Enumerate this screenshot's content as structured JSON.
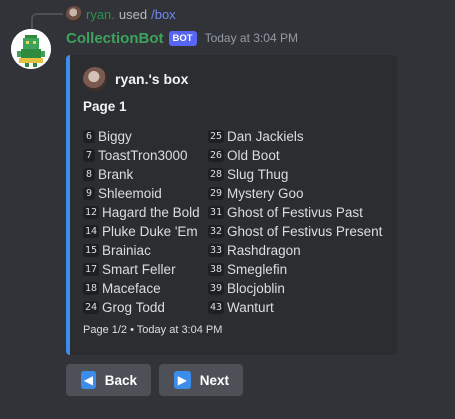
{
  "reply": {
    "user": "ryan.",
    "used": "used",
    "command": "/box"
  },
  "message": {
    "author": "CollectionBot",
    "tag": "BOT",
    "timestamp": "Today at 3:04 PM"
  },
  "embed": {
    "accent": "#3c8dea",
    "author": "ryan.'s box",
    "page_title": "Page 1",
    "left_items": [
      {
        "num": "6",
        "name": "Biggy"
      },
      {
        "num": "7",
        "name": "ToastTron3000"
      },
      {
        "num": "8",
        "name": "Brank"
      },
      {
        "num": "9",
        "name": "Shleemoid"
      },
      {
        "num": "12",
        "name": "Hagard the Bold"
      },
      {
        "num": "14",
        "name": "Pluke Duke 'Em"
      },
      {
        "num": "15",
        "name": "Brainiac"
      },
      {
        "num": "17",
        "name": "Smart Feller"
      },
      {
        "num": "18",
        "name": "Maceface"
      },
      {
        "num": "24",
        "name": "Grog Todd"
      }
    ],
    "right_items": [
      {
        "num": "25",
        "name": "Dan Jackiels"
      },
      {
        "num": "26",
        "name": "Old Boot"
      },
      {
        "num": "28",
        "name": "Slug Thug"
      },
      {
        "num": "29",
        "name": "Mystery Goo"
      },
      {
        "num": "31",
        "name": "Ghost of Festivus Past"
      },
      {
        "num": "32",
        "name": "Ghost of Festivus Present"
      },
      {
        "num": "33",
        "name": "Rashdragon"
      },
      {
        "num": "38",
        "name": "Smeglefin"
      },
      {
        "num": "39",
        "name": "Blocjoblin"
      },
      {
        "num": "43",
        "name": "Wanturt"
      }
    ],
    "footer": "Page 1/2 • Today at 3:04 PM"
  },
  "buttons": {
    "back": {
      "label": "Back",
      "icon": "left-arrow-icon"
    },
    "next": {
      "label": "Next",
      "icon": "right-arrow-icon"
    }
  }
}
